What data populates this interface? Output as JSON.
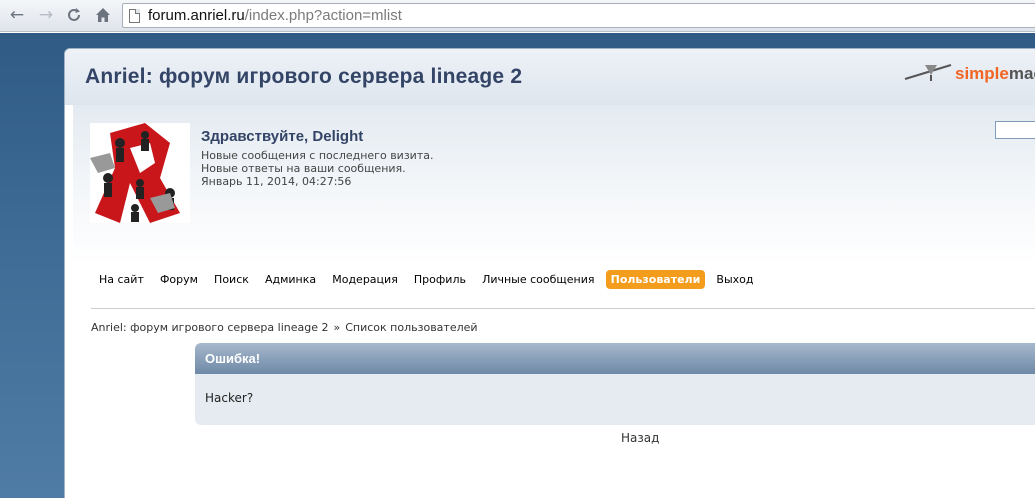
{
  "browser": {
    "url_host": "forum.anriel.ru",
    "url_path": "/index.php?action=mlist",
    "icons": [
      "back-arrow-icon",
      "forward-arrow-icon",
      "reload-icon",
      "home-icon",
      "page-icon"
    ]
  },
  "header": {
    "forum_name": "Anriel: форум игрового сервера lineage 2",
    "logo_text_a": "simple",
    "logo_text_b": "mac"
  },
  "user": {
    "greeting": "Здравствуйте, Delight",
    "new_posts": "Новые сообщения с последнего визита.",
    "new_replies": "Новые ответы на ваши сообщения.",
    "datetime": "Январь 11, 2014, 04:27:56"
  },
  "menu": {
    "items": [
      {
        "label": "На сайт"
      },
      {
        "label": "Форум"
      },
      {
        "label": "Поиск"
      },
      {
        "label": "Админка"
      },
      {
        "label": "Модерация"
      },
      {
        "label": "Профиль"
      },
      {
        "label": "Личные сообщения"
      },
      {
        "label": "Пользователи"
      },
      {
        "label": "Выход"
      }
    ],
    "active_index": 7
  },
  "breadcrumb": {
    "home": "Anriel: форум игрового сервера lineage 2",
    "separator": "»",
    "current": "Список пользователей"
  },
  "error": {
    "title": "Ошибка!",
    "message": "Hacker?",
    "back_label": "Назад"
  },
  "colors": {
    "menu_active": "#f49c1b",
    "forum_title": "#334466",
    "logo_orange": "#f26522"
  }
}
